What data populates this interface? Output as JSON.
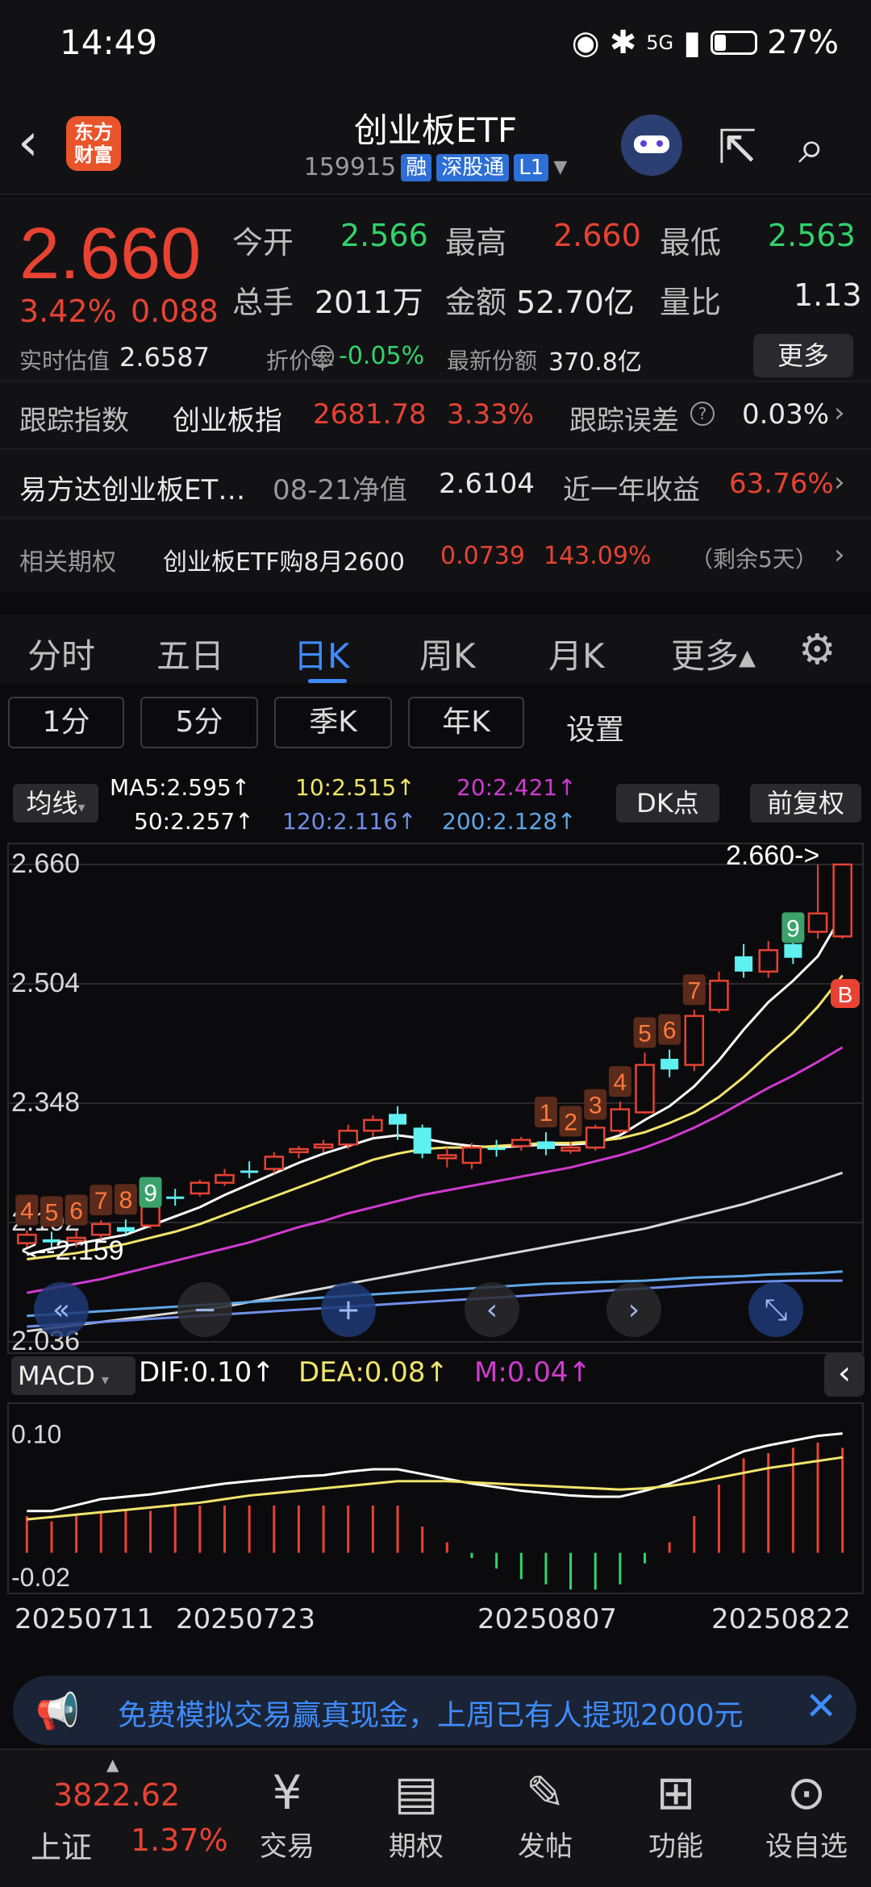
{
  "status": {
    "time": "14:49",
    "battery": "27%",
    "net": "5G"
  },
  "header": {
    "logo_text": "东方财富",
    "title": "创业板ETF",
    "code": "159915",
    "tags": [
      "融",
      "深股通",
      "L1"
    ]
  },
  "quote": {
    "price": "2.660",
    "change_pct": "3.42%",
    "change": "0.088",
    "open_label": "今开",
    "open": "2.566",
    "high_label": "最高",
    "high": "2.660",
    "low_label": "最低",
    "low": "2.563",
    "volume_label": "总手",
    "volume": "2011万",
    "amount_label": "金额",
    "amount": "52.70亿",
    "ratio_label": "量比",
    "ratio": "1.13",
    "iopv_label": "实时估值",
    "iopv": "2.6587",
    "discount_label": "折价率",
    "discount": "-0.05%",
    "shares_label": "最新份额",
    "shares": "370.8亿",
    "more": "更多"
  },
  "tracking": {
    "label": "跟踪指数",
    "index": "创业板指",
    "value": "2681.78",
    "pct": "3.33%",
    "err_label": "跟踪误差",
    "err": "0.03%"
  },
  "fund": {
    "name": "易方达创业板ET…",
    "nav_label": "08-21净值",
    "nav": "2.6104",
    "ret_label": "近一年收益",
    "ret": "63.76%"
  },
  "option": {
    "label": "相关期权",
    "name": "创业板ETF购8月2600",
    "price": "0.0739",
    "pct": "143.09%",
    "remain": "（剩余5天）"
  },
  "tabs": [
    "分时",
    "五日",
    "日K",
    "周K",
    "月K",
    "更多▴"
  ],
  "periods": [
    "1分",
    "5分",
    "季K",
    "年K",
    "设置"
  ],
  "ma_legend": {
    "label": "均线",
    "ma5": "MA5:2.595↑",
    "ma10": "10:2.515↑",
    "ma20": "20:2.421↑",
    "ma50": "50:2.257↑",
    "ma120": "120:2.116↑",
    "ma200": "200:2.128↑",
    "dk": "DK点",
    "fq": "前复权"
  },
  "macd_legend": {
    "label": "MACD",
    "dif": "DIF:0.10↑",
    "dea": "DEA:0.08↑",
    "m": "M:0.04↑"
  },
  "dates": [
    "20250711",
    "20250723",
    "20250807",
    "20250822"
  ],
  "banner": "免费模拟交易赢真现金，上周已有人提现2000元",
  "bottom": {
    "index_value": "3822.62",
    "index_name": "上证",
    "index_pct": "1.37%",
    "items": [
      "交易",
      "期权",
      "发帖",
      "功能",
      "设自选"
    ]
  },
  "colors": {
    "up": "#e84233",
    "down": "#31d46b",
    "accent": "#3f8cff",
    "cyan": "#5ff0f0"
  },
  "chart_data": {
    "type": "candlestick",
    "y_ticks": [
      "2.660",
      "2.504",
      "2.348",
      "2.192",
      "2.036"
    ],
    "ylim": [
      2.036,
      2.66
    ],
    "annotations": {
      "high": "2.660->",
      "low": "<--2.159",
      "b_label": "B",
      "td_labels": [
        "4",
        "5",
        "6",
        "7",
        "8",
        "9",
        "1",
        "2",
        "3",
        "4",
        "5",
        "6",
        "7",
        "9"
      ]
    },
    "candles": [
      {
        "o": 2.165,
        "c": 2.176,
        "h": 2.182,
        "l": 2.158
      },
      {
        "o": 2.17,
        "c": 2.166,
        "h": 2.18,
        "l": 2.159
      },
      {
        "o": 2.168,
        "c": 2.172,
        "h": 2.182,
        "l": 2.16
      },
      {
        "o": 2.176,
        "c": 2.19,
        "h": 2.195,
        "l": 2.17
      },
      {
        "o": 2.186,
        "c": 2.18,
        "h": 2.196,
        "l": 2.176
      },
      {
        "o": 2.188,
        "c": 2.214,
        "h": 2.218,
        "l": 2.184
      },
      {
        "o": 2.226,
        "c": 2.224,
        "h": 2.236,
        "l": 2.214
      },
      {
        "o": 2.23,
        "c": 2.244,
        "h": 2.248,
        "l": 2.226
      },
      {
        "o": 2.244,
        "c": 2.254,
        "h": 2.262,
        "l": 2.24
      },
      {
        "o": 2.26,
        "c": 2.259,
        "h": 2.272,
        "l": 2.25
      },
      {
        "o": 2.262,
        "c": 2.278,
        "h": 2.284,
        "l": 2.256
      },
      {
        "o": 2.284,
        "c": 2.288,
        "h": 2.292,
        "l": 2.276
      },
      {
        "o": 2.29,
        "c": 2.294,
        "h": 2.3,
        "l": 2.284
      },
      {
        "o": 2.294,
        "c": 2.312,
        "h": 2.32,
        "l": 2.288
      },
      {
        "o": 2.312,
        "c": 2.326,
        "h": 2.332,
        "l": 2.304
      },
      {
        "o": 2.334,
        "c": 2.32,
        "h": 2.344,
        "l": 2.3
      },
      {
        "o": 2.316,
        "c": 2.282,
        "h": 2.32,
        "l": 2.276
      },
      {
        "o": 2.276,
        "c": 2.28,
        "h": 2.29,
        "l": 2.264
      },
      {
        "o": 2.27,
        "c": 2.29,
        "h": 2.296,
        "l": 2.262
      },
      {
        "o": 2.29,
        "c": 2.288,
        "h": 2.3,
        "l": 2.278
      },
      {
        "o": 2.292,
        "c": 2.3,
        "h": 2.304,
        "l": 2.286
      },
      {
        "o": 2.298,
        "c": 2.288,
        "h": 2.31,
        "l": 2.28
      },
      {
        "o": 2.286,
        "c": 2.29,
        "h": 2.298,
        "l": 2.282
      },
      {
        "o": 2.29,
        "c": 2.316,
        "h": 2.32,
        "l": 2.286
      },
      {
        "o": 2.312,
        "c": 2.34,
        "h": 2.35,
        "l": 2.308
      },
      {
        "o": 2.336,
        "c": 2.398,
        "h": 2.414,
        "l": 2.334
      },
      {
        "o": 2.406,
        "c": 2.392,
        "h": 2.418,
        "l": 2.382
      },
      {
        "o": 2.398,
        "c": 2.462,
        "h": 2.47,
        "l": 2.39
      },
      {
        "o": 2.47,
        "c": 2.508,
        "h": 2.52,
        "l": 2.466
      },
      {
        "o": 2.54,
        "c": 2.52,
        "h": 2.556,
        "l": 2.512
      },
      {
        "o": 2.52,
        "c": 2.548,
        "h": 2.56,
        "l": 2.512
      },
      {
        "o": 2.556,
        "c": 2.538,
        "h": 2.58,
        "l": 2.53
      },
      {
        "o": 2.572,
        "c": 2.596,
        "h": 2.66,
        "l": 2.563
      },
      {
        "o": 2.566,
        "c": 2.66,
        "h": 2.66,
        "l": 2.563
      }
    ],
    "ma_series": [
      {
        "name": "MA5",
        "color": "#ffffff",
        "values": [
          2.15,
          2.158,
          2.164,
          2.17,
          2.176,
          2.188,
          2.2,
          2.212,
          2.228,
          2.242,
          2.256,
          2.27,
          2.282,
          2.292,
          2.302,
          2.306,
          2.302,
          2.296,
          2.292,
          2.29,
          2.292,
          2.294,
          2.294,
          2.296,
          2.306,
          2.326,
          2.344,
          2.37,
          2.404,
          2.444,
          2.48,
          2.508,
          2.54,
          2.595
        ]
      },
      {
        "name": "MA10",
        "color": "#f1e46a",
        "values": [
          2.144,
          2.148,
          2.152,
          2.158,
          2.164,
          2.172,
          2.18,
          2.19,
          2.202,
          2.214,
          2.226,
          2.238,
          2.25,
          2.262,
          2.274,
          2.282,
          2.288,
          2.29,
          2.29,
          2.292,
          2.294,
          2.296,
          2.296,
          2.298,
          2.302,
          2.31,
          2.322,
          2.336,
          2.356,
          2.382,
          2.412,
          2.44,
          2.474,
          2.515
        ]
      },
      {
        "name": "MA20",
        "color": "#d03ad0",
        "values": [
          2.1,
          2.106,
          2.112,
          2.118,
          2.126,
          2.134,
          2.142,
          2.15,
          2.158,
          2.166,
          2.176,
          2.186,
          2.194,
          2.204,
          2.212,
          2.22,
          2.228,
          2.234,
          2.24,
          2.246,
          2.252,
          2.258,
          2.264,
          2.272,
          2.28,
          2.29,
          2.302,
          2.316,
          2.332,
          2.35,
          2.368,
          2.384,
          2.402,
          2.421
        ]
      },
      {
        "name": "MA50",
        "color": "#d8d8d8",
        "values": [
          2.05,
          2.054,
          2.058,
          2.062,
          2.066,
          2.07,
          2.074,
          2.078,
          2.082,
          2.088,
          2.094,
          2.1,
          2.106,
          2.112,
          2.118,
          2.124,
          2.13,
          2.136,
          2.142,
          2.148,
          2.154,
          2.16,
          2.166,
          2.172,
          2.178,
          2.184,
          2.192,
          2.2,
          2.208,
          2.216,
          2.226,
          2.236,
          2.246,
          2.257
        ]
      },
      {
        "name": "MA120",
        "color": "#6f8fe8",
        "values": [
          2.056,
          2.058,
          2.06,
          2.062,
          2.064,
          2.066,
          2.068,
          2.07,
          2.072,
          2.074,
          2.076,
          2.078,
          2.08,
          2.082,
          2.084,
          2.086,
          2.088,
          2.09,
          2.092,
          2.094,
          2.096,
          2.098,
          2.1,
          2.102,
          2.104,
          2.106,
          2.108,
          2.11,
          2.112,
          2.114,
          2.115,
          2.116,
          2.116,
          2.116
        ]
      },
      {
        "name": "MA200",
        "color": "#5fa6e8",
        "values": [
          2.07,
          2.072,
          2.074,
          2.076,
          2.078,
          2.08,
          2.082,
          2.084,
          2.086,
          2.088,
          2.09,
          2.092,
          2.094,
          2.096,
          2.098,
          2.1,
          2.102,
          2.104,
          2.106,
          2.108,
          2.11,
          2.112,
          2.113,
          2.114,
          2.115,
          2.116,
          2.118,
          2.12,
          2.121,
          2.122,
          2.124,
          2.125,
          2.126,
          2.128
        ]
      }
    ],
    "macd": {
      "y_ticks": [
        "0.10",
        "-0.02"
      ],
      "ylim": [
        -0.03,
        0.12
      ],
      "dif": [
        0.035,
        0.035,
        0.04,
        0.045,
        0.047,
        0.049,
        0.052,
        0.055,
        0.058,
        0.06,
        0.062,
        0.064,
        0.065,
        0.068,
        0.07,
        0.07,
        0.066,
        0.062,
        0.058,
        0.055,
        0.052,
        0.05,
        0.048,
        0.047,
        0.047,
        0.052,
        0.058,
        0.066,
        0.076,
        0.085,
        0.09,
        0.094,
        0.098,
        0.1
      ],
      "dea": [
        0.028,
        0.03,
        0.032,
        0.034,
        0.036,
        0.038,
        0.04,
        0.042,
        0.045,
        0.048,
        0.05,
        0.052,
        0.054,
        0.056,
        0.058,
        0.06,
        0.06,
        0.06,
        0.059,
        0.058,
        0.057,
        0.056,
        0.055,
        0.054,
        0.053,
        0.054,
        0.056,
        0.059,
        0.063,
        0.067,
        0.071,
        0.074,
        0.077,
        0.08
      ],
      "m": [
        0.014,
        0.012,
        0.014,
        0.016,
        0.016,
        0.016,
        0.018,
        0.018,
        0.018,
        0.018,
        0.018,
        0.018,
        0.018,
        0.018,
        0.018,
        0.018,
        0.01,
        0.004,
        -0.002,
        -0.006,
        -0.01,
        -0.012,
        -0.014,
        -0.014,
        -0.012,
        -0.004,
        0.004,
        0.014,
        0.026,
        0.036,
        0.038,
        0.04,
        0.042,
        0.04
      ]
    }
  }
}
